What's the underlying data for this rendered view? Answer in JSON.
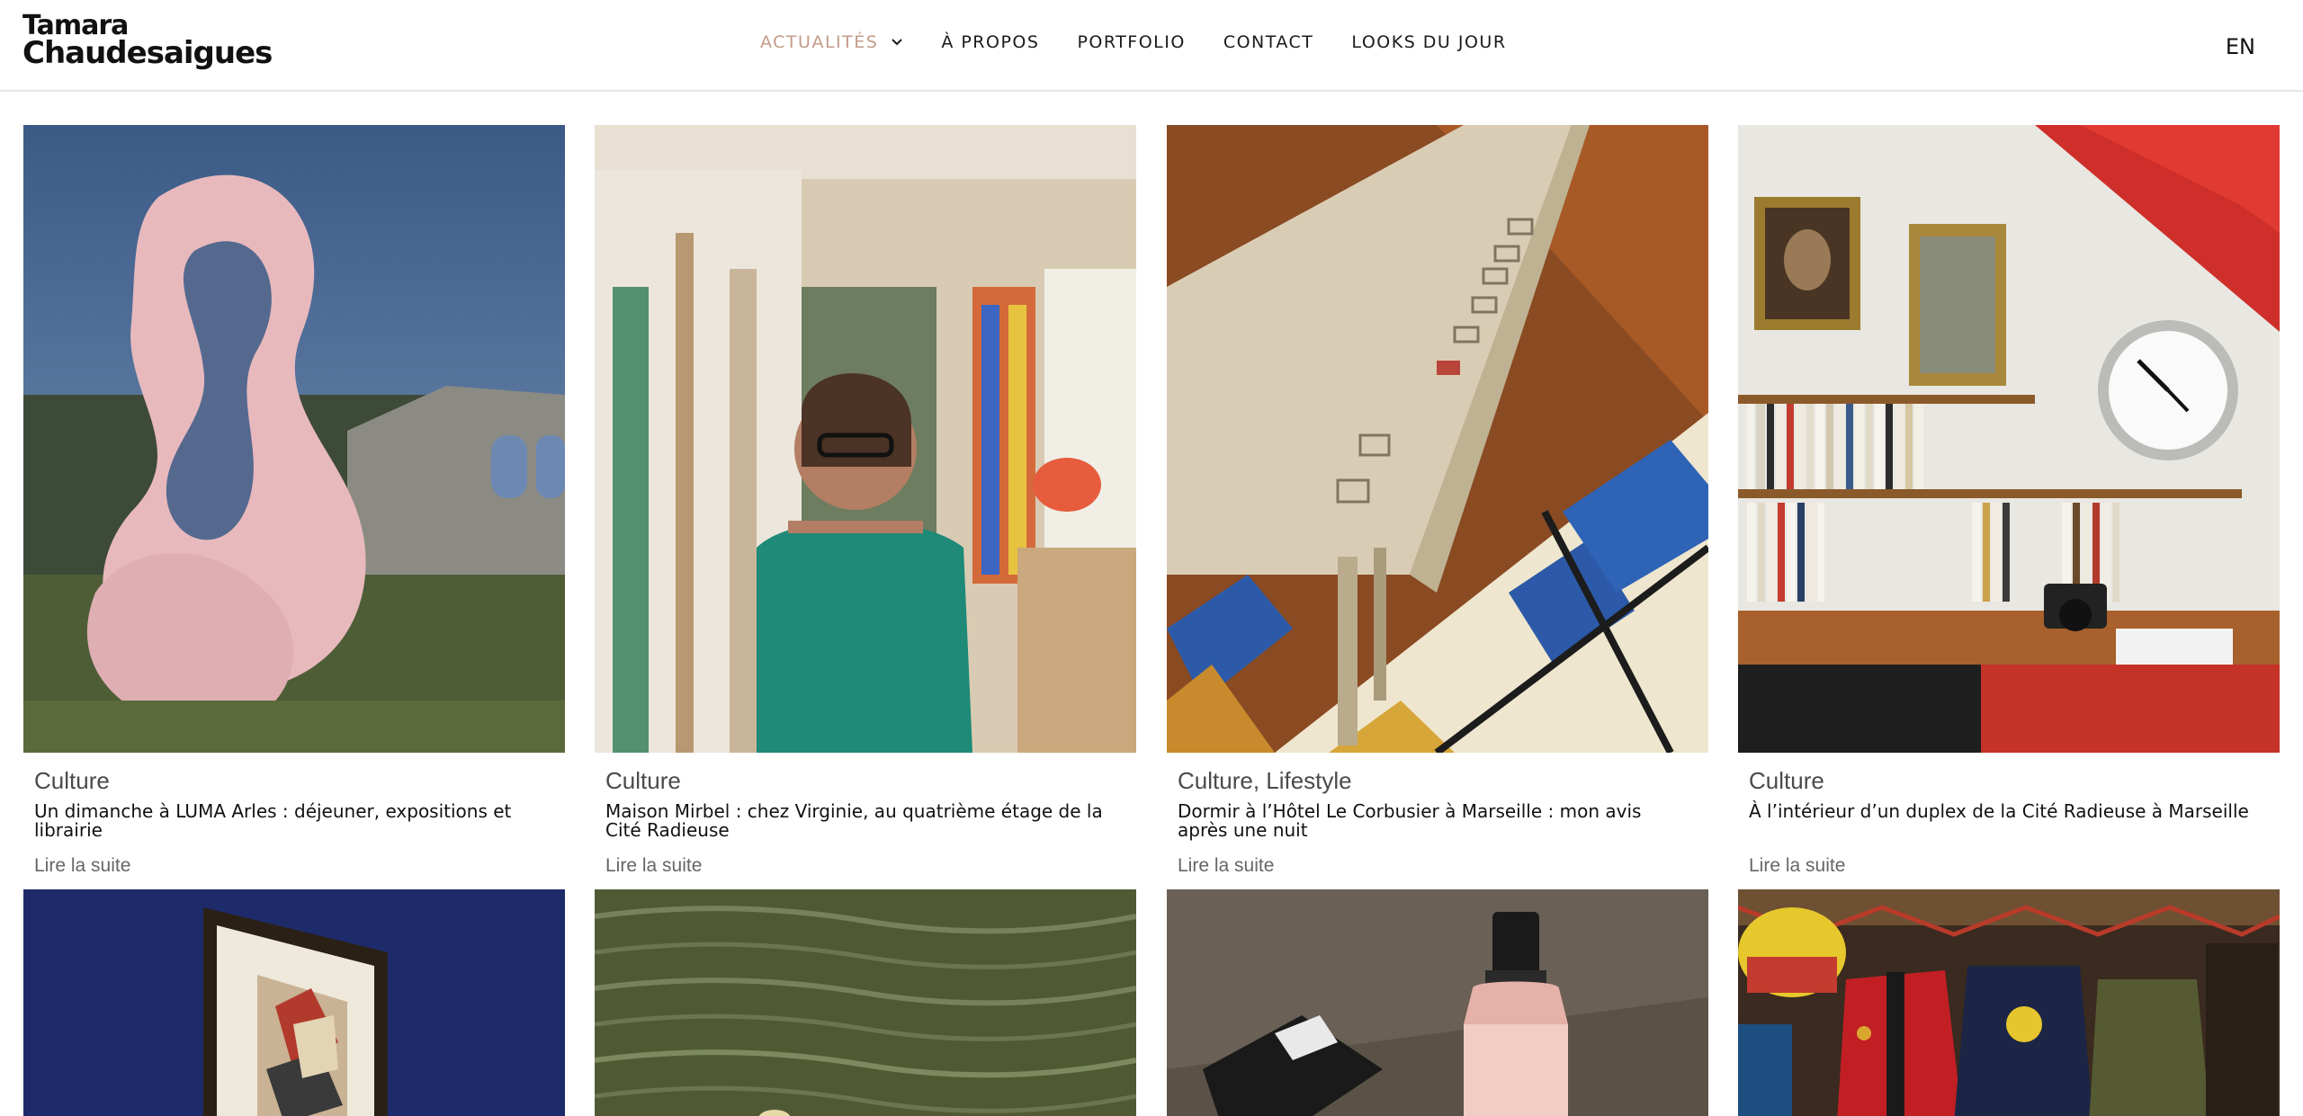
{
  "brand": {
    "line1": "Tamara",
    "line2": "Chaudesaigues"
  },
  "nav": {
    "items": [
      {
        "label": "ACTUALITÉS",
        "active": true
      },
      {
        "label": "À PROPOS"
      },
      {
        "label": "PORTFOLIO"
      },
      {
        "label": "CONTACT"
      },
      {
        "label": "LOOKS DU JOUR"
      }
    ],
    "language": "EN"
  },
  "colors": {
    "accent": "#c49b8a",
    "text": "#111111",
    "muted": "#666666"
  },
  "posts": [
    {
      "category": "Culture",
      "title": "Un dimanche à LUMA Arles : déjeuner, expositions et librairie",
      "read_more": "Lire la suite",
      "image": "pink-knot-sculpture"
    },
    {
      "category": "Culture",
      "title": "Maison Mirbel : chez Virginie, au quatrième étage de la Cité Radieuse",
      "read_more": "Lire la suite",
      "image": "woman-in-colorful-apartment"
    },
    {
      "category": "Culture, Lifestyle",
      "title": "Dormir à l’Hôtel Le Corbusier à Marseille : mon avis après une nuit",
      "read_more": "Lire la suite",
      "image": "bench-on-patchwork-rug"
    },
    {
      "category": "Culture",
      "title": "À l’intérieur d’un duplex de la Cité Radieuse à Marseille",
      "read_more": "Lire la suite",
      "image": "bookshelf-with-clock"
    }
  ],
  "posts_row2": [
    {
      "image": "framed-artwork"
    },
    {
      "image": "water-surface"
    },
    {
      "image": "cosmetic-bottle"
    },
    {
      "image": "vintage-clothing-shop"
    }
  ]
}
